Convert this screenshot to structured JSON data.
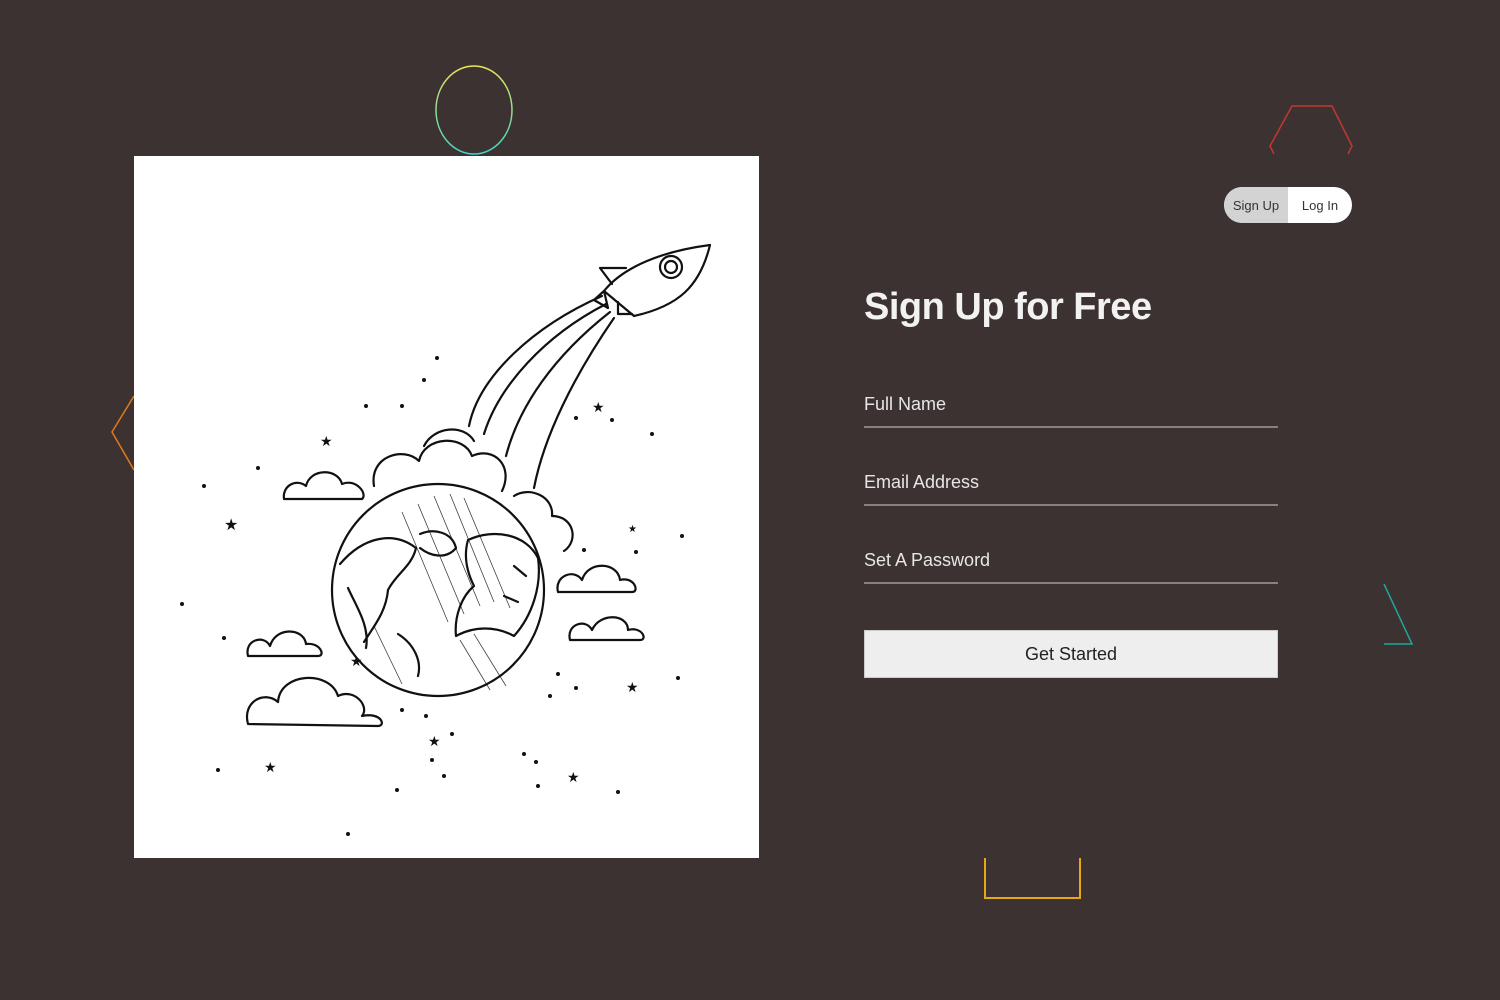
{
  "auth_toggle": {
    "signup_label": "Sign Up",
    "login_label": "Log In",
    "active": "signup"
  },
  "form": {
    "title": "Sign Up for Free",
    "fields": [
      {
        "placeholder": "Full Name"
      },
      {
        "placeholder": "Email Address"
      },
      {
        "placeholder": "Set A Password"
      }
    ],
    "submit_label": "Get Started"
  },
  "illustration": {
    "icon": "rocket-earth-illustration"
  },
  "colors": {
    "background": "#3d3232",
    "card": "#ffffff",
    "button": "#efeeee",
    "field_line": "#8a8080"
  }
}
